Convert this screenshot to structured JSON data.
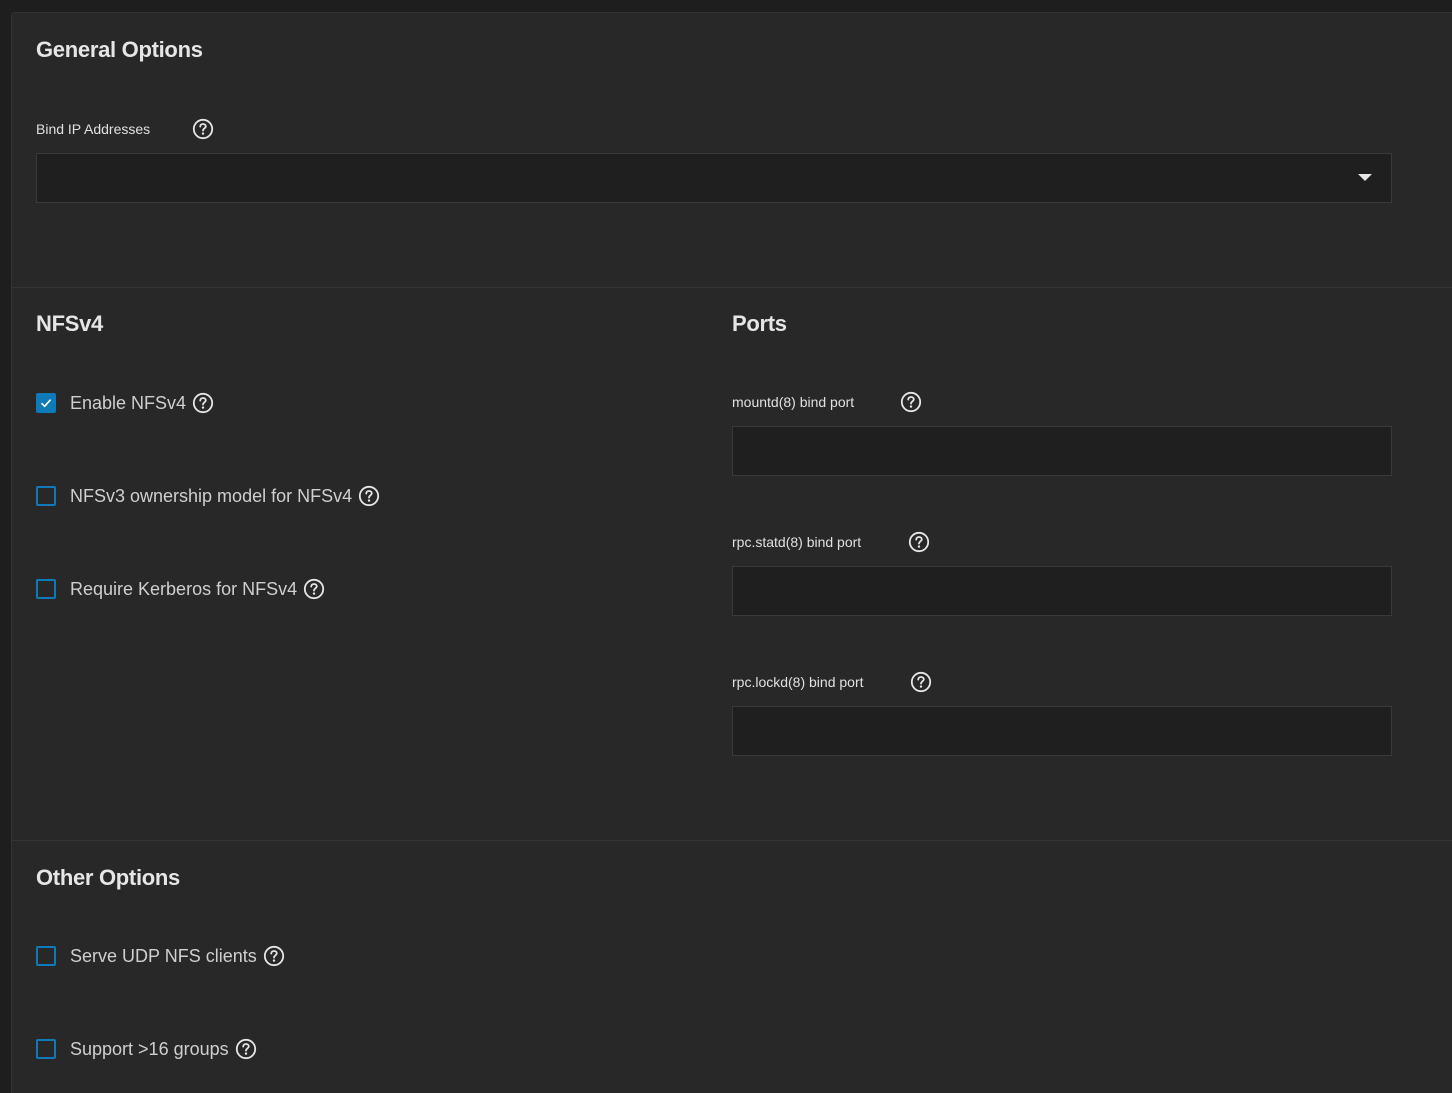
{
  "general": {
    "title": "General Options",
    "bind_ip": {
      "label": "Bind IP Addresses",
      "value": ""
    }
  },
  "nfsv4": {
    "title": "NFSv4",
    "options": [
      {
        "label": "Enable NFSv4",
        "checked": true
      },
      {
        "label": "NFSv3 ownership model for NFSv4",
        "checked": false
      },
      {
        "label": "Require Kerberos for NFSv4",
        "checked": false
      }
    ]
  },
  "ports": {
    "title": "Ports",
    "fields": [
      {
        "label": "mountd(8) bind port",
        "value": ""
      },
      {
        "label": "rpc.statd(8) bind port",
        "value": ""
      },
      {
        "label": "rpc.lockd(8) bind port",
        "value": ""
      }
    ]
  },
  "other": {
    "title": "Other Options",
    "options": [
      {
        "label": "Serve UDP NFS clients",
        "checked": false
      },
      {
        "label": "Support >16 groups",
        "checked": false
      }
    ]
  },
  "colors": {
    "background": "#1e1e1e",
    "card": "#282828",
    "accent": "#0f7ab8",
    "input_bg": "#1f1f1f"
  },
  "icons": {
    "help": "help-circle-icon",
    "dropdown": "caret-down-icon",
    "check": "checkmark-icon"
  }
}
